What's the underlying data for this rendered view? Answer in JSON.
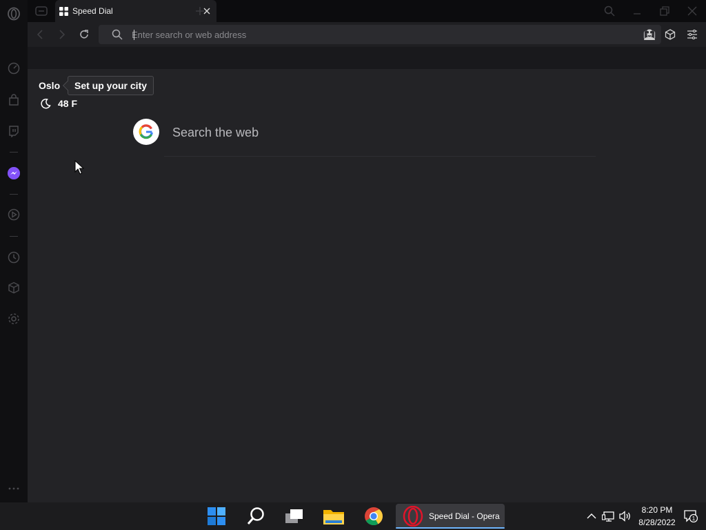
{
  "tabs": [
    {
      "label": "Speed Dial",
      "icon": "speed-dial-icon",
      "active": true
    }
  ],
  "address_bar": {
    "placeholder": "Enter search or web address",
    "value": ""
  },
  "weather": {
    "city": "Oslo",
    "tooltip": "Set up your city",
    "temperature": "48 F",
    "condition_icon": "moon-icon"
  },
  "search": {
    "engine_icon": "google-logo-icon",
    "placeholder": "Search the web"
  },
  "taskbar": {
    "active_app_label": "Speed Dial - Opera",
    "time": "8:20 PM",
    "date": "8/28/2022",
    "notification_count": "1"
  },
  "colors": {
    "accent": "#6fb6ff",
    "opera_red": "#e0142a",
    "background": "#232326"
  }
}
